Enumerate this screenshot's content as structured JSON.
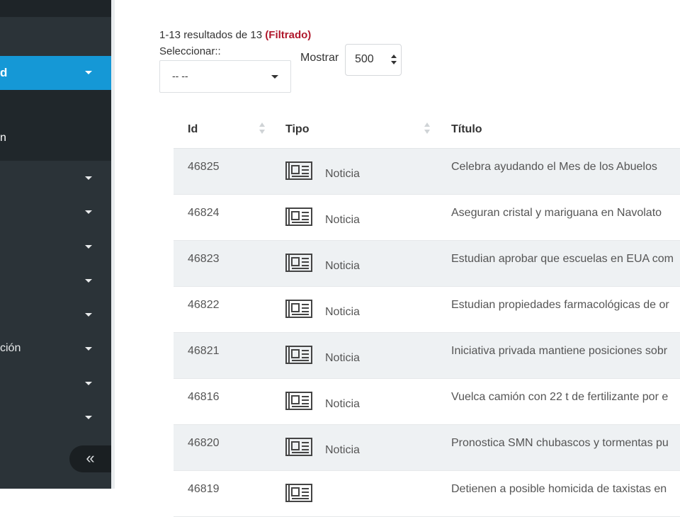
{
  "sidebar": {
    "active_item": {
      "label": "d"
    },
    "submenu": {
      "label": "n"
    },
    "items": [
      {
        "label": ""
      },
      {
        "label": ""
      },
      {
        "label": ""
      },
      {
        "label": ""
      },
      {
        "label": ""
      },
      {
        "label": "ción"
      },
      {
        "label": ""
      },
      {
        "label": ""
      }
    ],
    "collapse_label": "«"
  },
  "results": {
    "summary": "1-13 resultados de 13",
    "filtered": "(Filtrado)"
  },
  "selector": {
    "label": "Seleccionar::",
    "value": "-- --"
  },
  "page_size": {
    "label": "Mostrar",
    "value": "500"
  },
  "table": {
    "columns": [
      "Id",
      "Tipo",
      "Título"
    ],
    "rows": [
      {
        "id": "46825",
        "tipo": "Noticia",
        "titulo": "Celebra ayudando el Mes de los Abuelos"
      },
      {
        "id": "46824",
        "tipo": "Noticia",
        "titulo": "Aseguran cristal y mariguana en Navolato"
      },
      {
        "id": "46823",
        "tipo": "Noticia",
        "titulo": "Estudian aprobar que escuelas en EUA com"
      },
      {
        "id": "46822",
        "tipo": "Noticia",
        "titulo": "Estudian propiedades farmacológicas de or"
      },
      {
        "id": "46821",
        "tipo": "Noticia",
        "titulo": "Iniciativa privada mantiene posiciones sobr"
      },
      {
        "id": "46816",
        "tipo": "Noticia",
        "titulo": "Vuelca camión con 22 t de fertilizante por e"
      },
      {
        "id": "46820",
        "tipo": "Noticia",
        "titulo": "Pronostica SMN chubascos y tormentas pu"
      },
      {
        "id": "46819",
        "tipo": "",
        "titulo": "Detienen a posible homicida de taxistas en"
      }
    ]
  },
  "colors": {
    "sidebar_bg": "#2b3338",
    "active_bg": "#1598d6",
    "filtered_text": "#b0182c",
    "row_stripe": "#eef1f3"
  },
  "icons": {
    "row_type": "newspaper-icon",
    "sort": "sort-icon",
    "dropdown": "chevron-down-icon",
    "collapse": "double-chevron-left-icon"
  }
}
